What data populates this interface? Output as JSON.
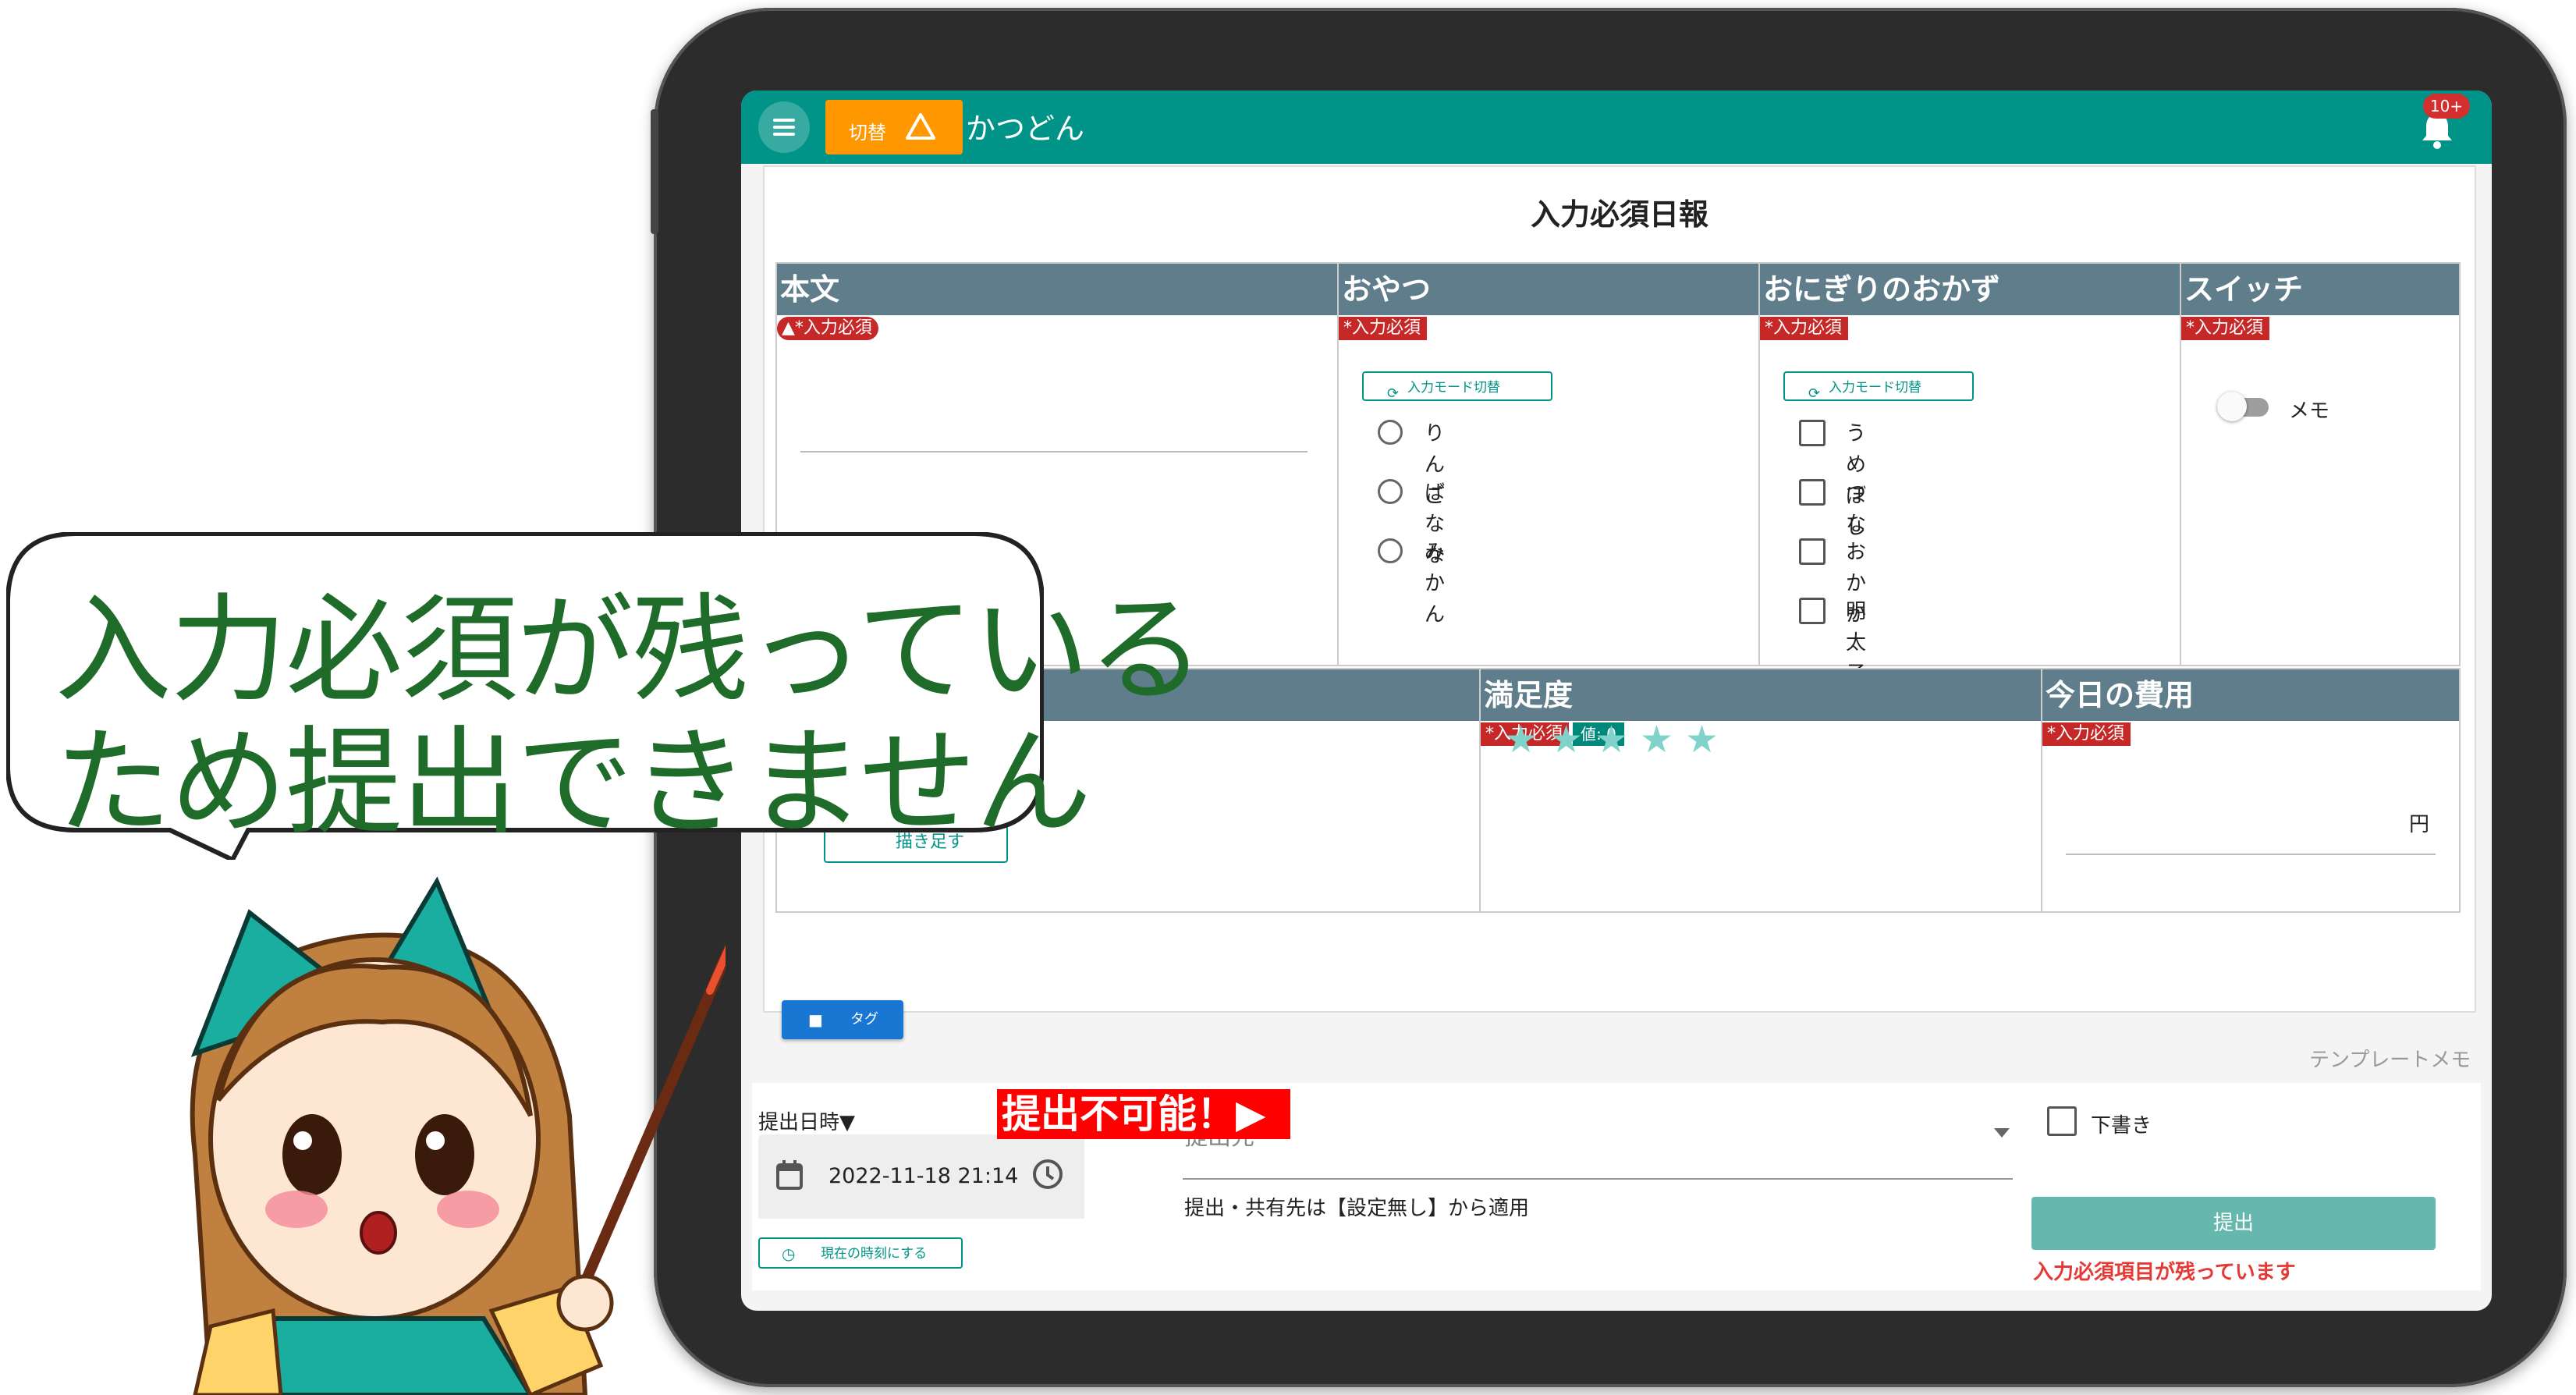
{
  "app": {
    "menu_icon": "hamburger-menu-icon",
    "switch_label": "切替",
    "switch_icon": "warning-triangle-icon",
    "title": "かつどん",
    "notification_badge": "10+",
    "notification_icon": "bell-icon",
    "accent": "#009387",
    "switch_color": "#ff9800"
  },
  "form": {
    "title": "入力必須日報",
    "required_label": "入力必須",
    "required_label_star": "*入力必須",
    "required_label_warn": "▲*入力必須",
    "mode_switch_label": "入力モード切替",
    "fields": {
      "honbun": {
        "label": "本文"
      },
      "oyatsu": {
        "label": "おやつ",
        "options": [
          "りんご",
          "ばなな",
          "みかん"
        ]
      },
      "onigiri": {
        "label": "おにぎりのおかず",
        "options": [
          "うめぼし",
          "つな",
          "おかか",
          "明太子"
        ]
      },
      "switch": {
        "label": "スイッチ",
        "memo": "メモ"
      },
      "manzokudo": {
        "label": "満足度",
        "value_badge": "値: 0",
        "stars": 5,
        "rating": 0
      },
      "hiyou": {
        "label": "今日の費用",
        "unit": "円"
      },
      "drawing": {
        "button_label": "描き足す"
      }
    },
    "tag_button": "タグ",
    "template_memo": "テンプレートメモ"
  },
  "bottom": {
    "date_label": "提出日時▼",
    "date_value": "2022-11-18 21:14",
    "now_button": "現在の時刻にする",
    "destination_placeholder": "提出先",
    "destination_note": "提出・共有先は【設定無し】から適用",
    "draft_label": "下書き",
    "submit_label": "提出",
    "submit_error": "入力必須項目が残っています"
  },
  "banner": "提出不可能！▶",
  "bubble": {
    "line1": "入力必須が残っている",
    "line2": "ため提出できません"
  }
}
